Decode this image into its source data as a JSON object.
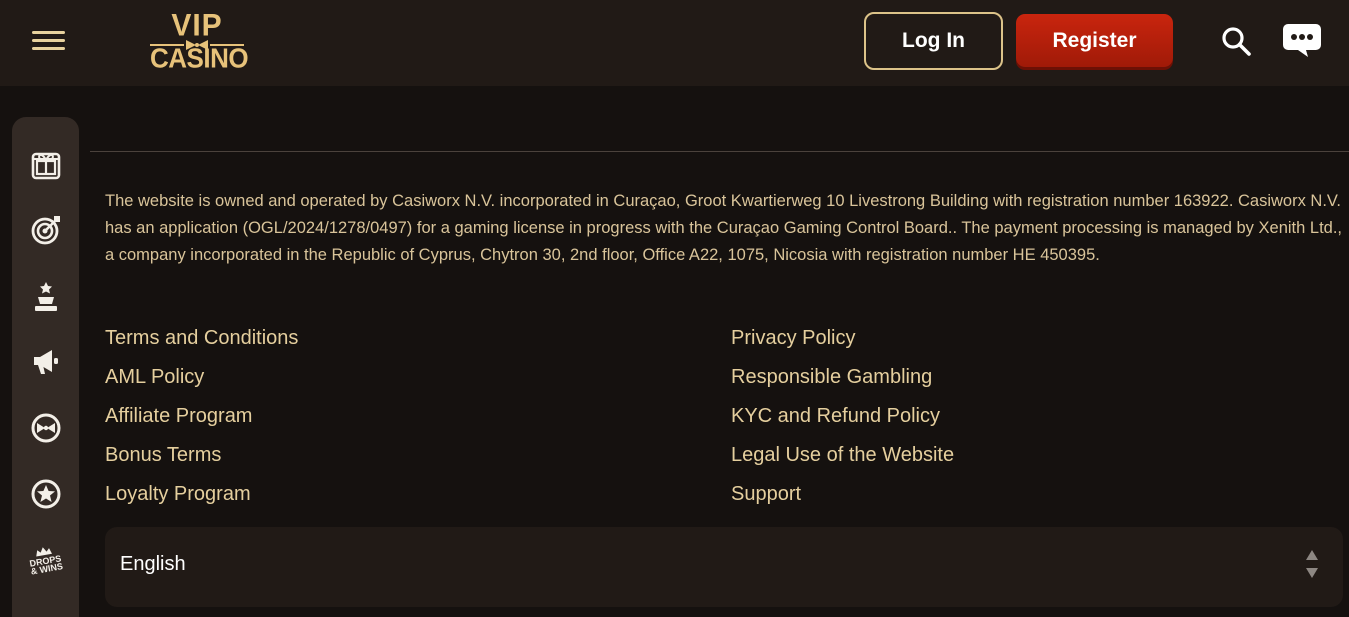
{
  "header": {
    "menu_icon": "hamburger-icon",
    "logo": {
      "line1": "VIP",
      "line2": "CASINO"
    },
    "login_label": "Log In",
    "register_label": "Register",
    "search_icon": "search-icon",
    "chat_icon": "chat-icon"
  },
  "sidebar": {
    "items": [
      {
        "icon": "gift-icon"
      },
      {
        "icon": "target-icon"
      },
      {
        "icon": "trophy-icon"
      },
      {
        "icon": "megaphone-icon"
      },
      {
        "icon": "bow-tie-icon"
      },
      {
        "icon": "star-badge-icon"
      },
      {
        "icon": "drops-wins-icon",
        "label_line1": "DROPS",
        "label_line2": "& WINS"
      }
    ]
  },
  "footer": {
    "legal_text": "The website is owned and operated by Casiworx N.V. incorporated in Curaçao, Groot Kwartierweg 10 Livestrong Building with registration number 163922. Casiworx N.V. has an application (OGL/2024/1278/0497) for a gaming license in progress with the Curaçao Gaming Control Board.. The payment processing is managed by Xenith Ltd., a company incorporated in the Republic of Cyprus, Chytron 30, 2nd floor, Office A22, 1075, Nicosia with registration number HE 450395.",
    "links_col1": [
      "Terms and Conditions",
      "AML Policy",
      "Affiliate Program",
      "Bonus Terms",
      "Loyalty Program"
    ],
    "links_col2": [
      "Privacy Policy",
      "Responsible Gambling",
      "KYC and Refund Policy",
      "Legal Use of the Website",
      "Support"
    ],
    "language": {
      "selected": "English"
    }
  },
  "colors": {
    "accent_gold": "#e7c27a",
    "register_red": "#b41f0b",
    "background": "#15110f",
    "header_bg": "#211a16"
  }
}
